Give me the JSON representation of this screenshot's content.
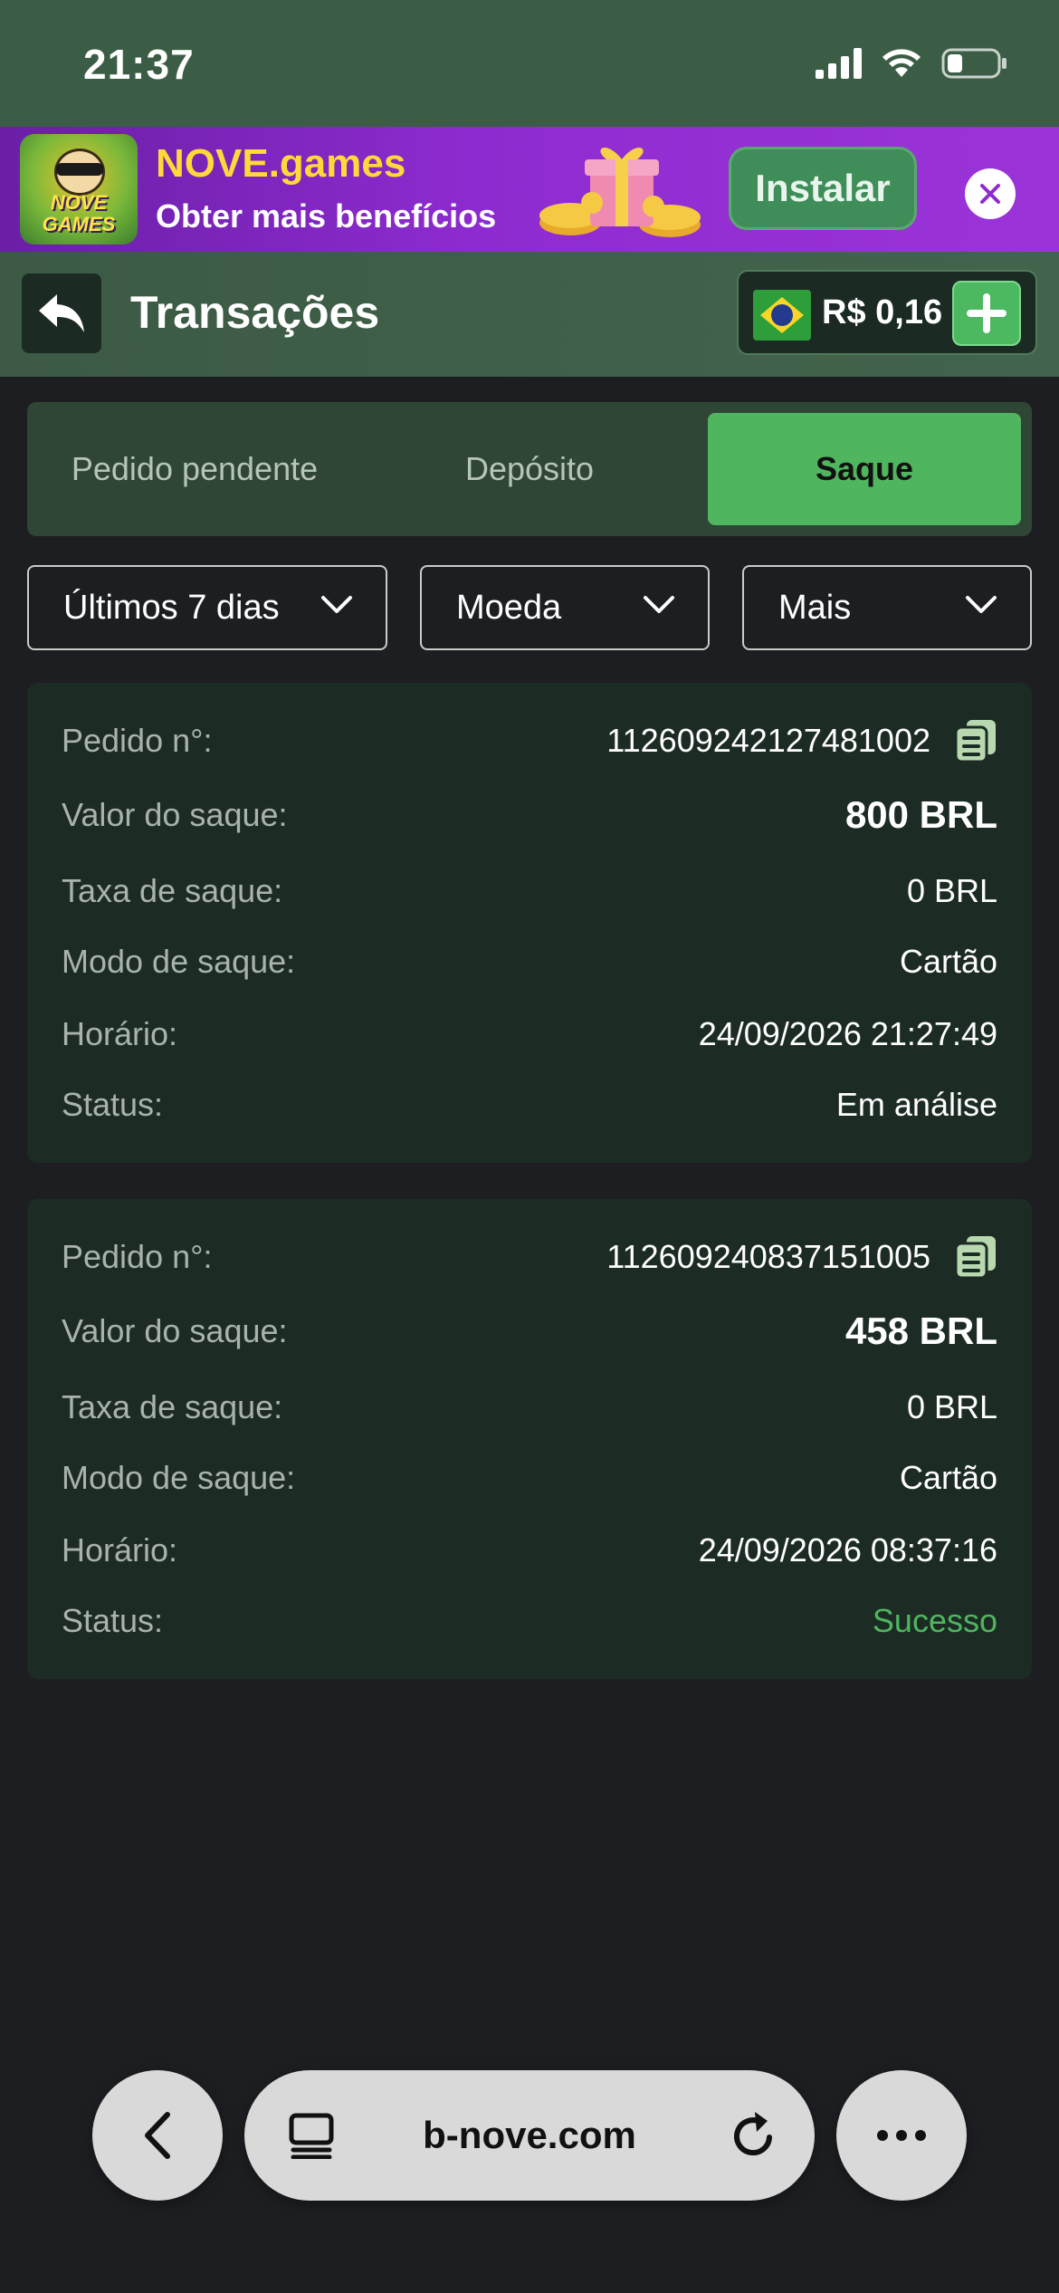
{
  "status_bar": {
    "time": "21:37"
  },
  "promo": {
    "logo_text": "NOVE GAMES",
    "title": "NOVE.games",
    "subtitle": "Obter mais benefícios",
    "install_label": "Instalar"
  },
  "header": {
    "title": "Transações",
    "balance": "R$ 0,16"
  },
  "tabs": [
    {
      "label": "Pedido pendente",
      "active": false
    },
    {
      "label": "Depósito",
      "active": false
    },
    {
      "label": "Saque",
      "active": true
    }
  ],
  "filters": {
    "period": "Últimos 7 dias",
    "currency": "Moeda",
    "more": "Mais"
  },
  "labels": {
    "order": "Pedido n°:",
    "amount": "Valor do saque:",
    "fee": "Taxa de saque:",
    "mode": "Modo de saque:",
    "time": "Horário:",
    "status": "Status:"
  },
  "transactions": [
    {
      "order_no": "112609242127481002",
      "amount": "800 BRL",
      "fee": "0 BRL",
      "mode": "Cartão",
      "time": "24/09/2026 21:27:49",
      "status": "Em análise"
    },
    {
      "order_no": "112609240837151005",
      "amount": "458 BRL",
      "fee": "0 BRL",
      "mode": "Cartão",
      "time": "24/09/2026 08:37:16",
      "status": "Sucesso"
    }
  ],
  "browser": {
    "url": "b-nove.com"
  },
  "colors": {
    "accent": "#4fb55f",
    "header_bg": "#3c5d45",
    "promo_bg": "#8e2bd0",
    "card_bg": "#1c2c24",
    "page_bg": "#1c1e21",
    "success": "#4fb55f"
  }
}
